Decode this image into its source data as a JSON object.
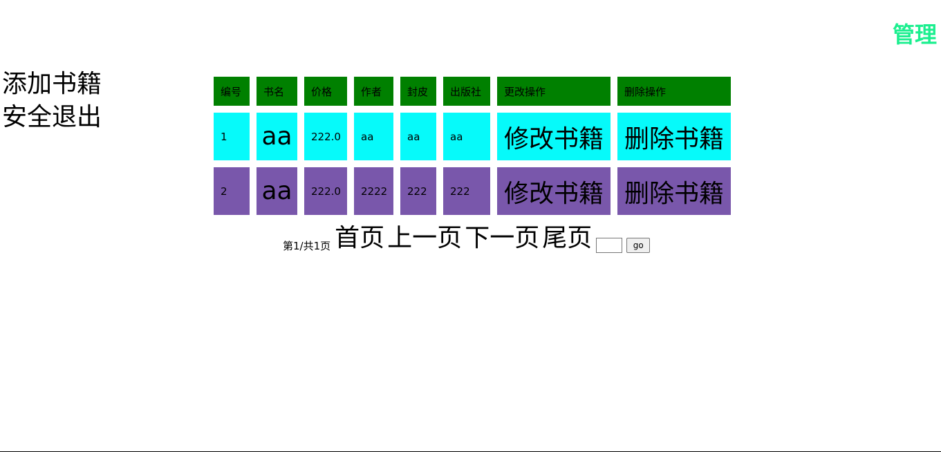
{
  "header": {
    "title": "管理"
  },
  "sidebar": {
    "items": [
      {
        "label": "添加书籍"
      },
      {
        "label": "安全退出"
      }
    ]
  },
  "table": {
    "columns": [
      "编号",
      "书名",
      "价格",
      "作者",
      "封皮",
      "出版社",
      "更改操作",
      "删除操作"
    ],
    "rows": [
      {
        "id": "1",
        "name": "aa",
        "price": "222.0",
        "author": "aa",
        "cover": "aa",
        "publisher": "aa",
        "edit": "修改书籍",
        "delete": "删除书籍"
      },
      {
        "id": "2",
        "name": "aa",
        "price": "222.0",
        "author": "2222",
        "cover": "222",
        "publisher": "222",
        "edit": "修改书籍",
        "delete": "删除书籍"
      }
    ],
    "colors": {
      "header": "#008000",
      "row1": "#06fafa",
      "row2": "#7957ab"
    }
  },
  "pagination": {
    "info": "第1/共1页",
    "first": "首页",
    "prev": "上一页",
    "next": "下一页",
    "last": "尾页",
    "input_value": "",
    "go_label": "go"
  },
  "colors": {
    "title_accent": "#1bef8f"
  }
}
